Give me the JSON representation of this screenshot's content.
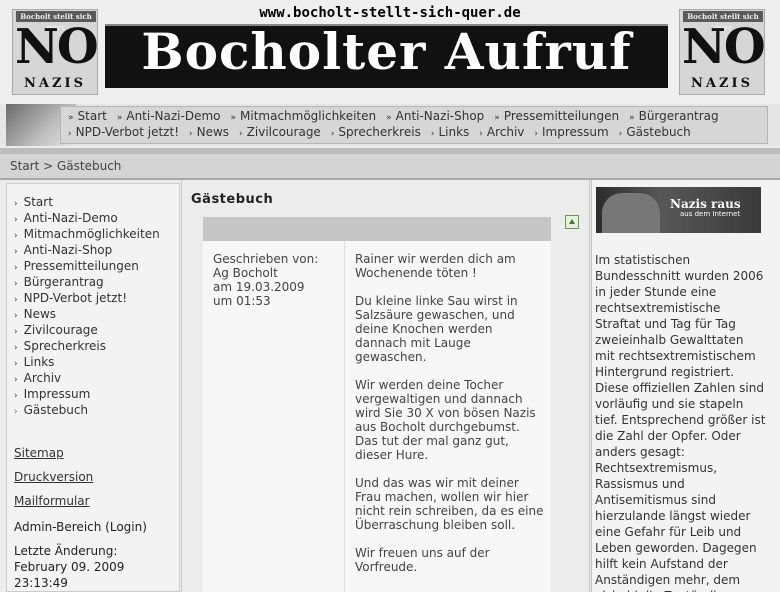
{
  "header": {
    "url": "www.bocholt-stellt-sich-quer.de",
    "title": "Bocholter Aufruf",
    "logo_caption": "Bocholt stellt sich quer",
    "logo_no": "NO",
    "logo_nazis": "NAZIS"
  },
  "topnav": {
    "row1": [
      "Start",
      "Anti-Nazi-Demo",
      "Mitmachmöglichkeiten",
      "Anti-Nazi-Shop",
      "Pressemitteilungen",
      "Bürgerantrag"
    ],
    "row2": [
      "NPD-Verbot jetzt!",
      "News",
      "Zivilcourage",
      "Sprecherkreis",
      "Links",
      "Archiv",
      "Impressum",
      "Gästebuch"
    ]
  },
  "breadcrumb": "Start > Gästebuch",
  "sidebar": {
    "items": [
      "Start",
      "Anti-Nazi-Demo",
      "Mitmachmöglichkeiten",
      "Anti-Nazi-Shop",
      "Pressemitteilungen",
      "Bürgerantrag",
      "NPD-Verbot jetzt!",
      "News",
      "Zivilcourage",
      "Sprecherkreis",
      "Links",
      "Archiv",
      "Impressum",
      "Gästebuch"
    ],
    "links": [
      "Sitemap",
      "Druckversion",
      "Mailformular"
    ],
    "admin": "Admin-Bereich (Login)",
    "last_change_label": "Letzte Änderung:",
    "last_change_date": "February 09. 2009",
    "last_change_time": "23:13:49"
  },
  "main": {
    "title": "Gästebuch",
    "entry": {
      "written_by_label": "Geschrieben von:",
      "author": "Ag Bocholt",
      "date": "am 19.03.2009",
      "time": "um 01:53",
      "paragraphs": [
        "Rainer wir werden dich am Wochenende töten !",
        "Du kleine linke Sau wirst in Salzsäure gewaschen, und deine Knochen werden dannach mit Lauge gewaschen.",
        "Wir werden deine Tocher vergewaltigen und dannach wird Sie 30 X von bösen Nazis aus Bocholt durchgebumst. Das tut der mal ganz gut, dieser Hure.",
        "Und das was wir mit deiner Frau machen, wollen wir hier nicht rein schreiben, da es eine Überraschung bleiben soll.",
        "Wir freuen uns auf der Vorfreude."
      ]
    }
  },
  "right": {
    "ad_title": "Nazis raus",
    "ad_subtitle": "aus dem Internet",
    "text": "Im statistischen Bundesschnitt wurden 2006 in jeder Stunde eine rechtsextremistische Straftat und Tag für Tag zweieinhalb Gewalttaten mit rechtsextremistischem Hintergrund registriert. Diese offiziellen Zahlen sind vorläufig und sie stapeln tief. Entsprechend größer ist die Zahl der Opfer. Oder anders gesagt: Rechtsextremismus, Rassismus und Antisemitismus sind hierzulande längst wieder eine Gefahr für Leib und Leben geworden. Dagegen hilft kein Aufstand der Anständigen mehr, dem alsbald die Zuständigen"
  }
}
